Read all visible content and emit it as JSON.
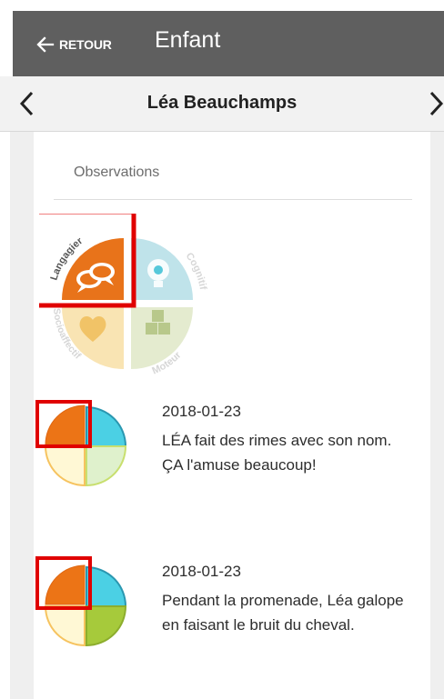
{
  "header": {
    "back_label": "RETOUR",
    "title": "Enfant"
  },
  "child_nav": {
    "name": "Léa Beauchamps"
  },
  "observations": {
    "section_title": "Observations",
    "wheel_labels": {
      "langagier": "Langagier",
      "cognitif": "Cognitif",
      "socioaffectif": "Socioaffectif",
      "moteur": "Moteur"
    },
    "items": [
      {
        "date": "2018-01-23",
        "text": "LÉA fait des rimes avec son nom. ÇA l'amuse beaucoup!"
      },
      {
        "date": "2018-01-23",
        "text": "Pendant la promenade, Léa galope en faisant le bruit du cheval."
      }
    ]
  },
  "colors": {
    "appbar": "#5f5f5f",
    "langagier": "#e8731a",
    "cognitif": "#4fc7d8",
    "socioaffectif": "#f8c45a",
    "moteur": "#a7c943",
    "highlight": "#e00000"
  }
}
